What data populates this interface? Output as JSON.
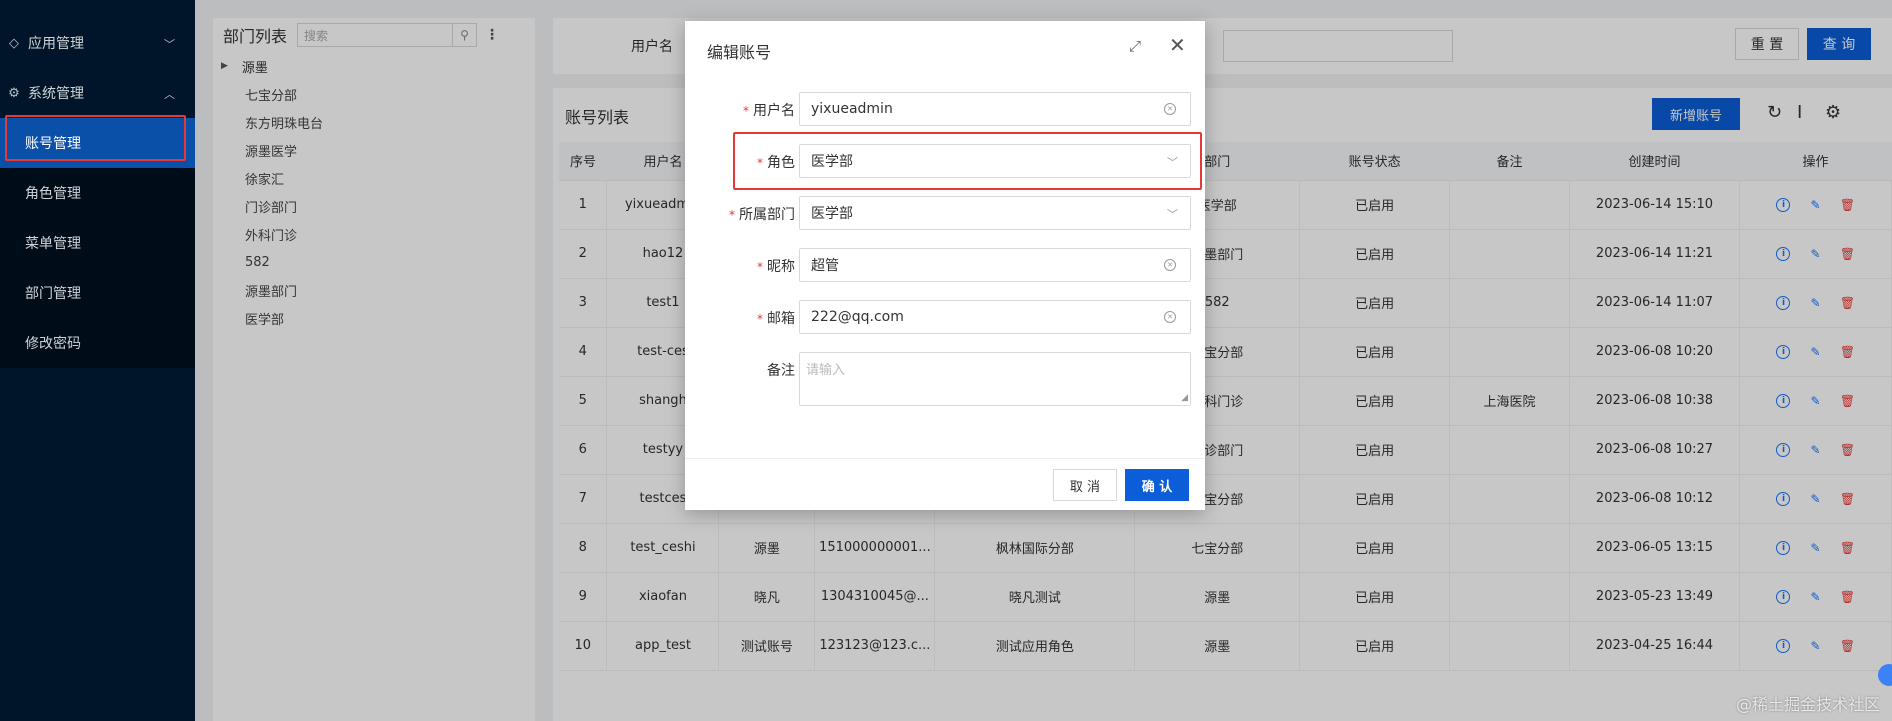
{
  "sidebar": {
    "groups": [
      {
        "label": "应用管理",
        "icon": "diamond-icon",
        "expanded": false
      },
      {
        "label": "系统管理",
        "icon": "gear-icon",
        "expanded": true
      }
    ],
    "items": [
      {
        "label": "账号管理",
        "active": true
      },
      {
        "label": "角色管理",
        "active": false
      },
      {
        "label": "菜单管理",
        "active": false
      },
      {
        "label": "部门管理",
        "active": false
      },
      {
        "label": "修改密码",
        "active": false
      }
    ]
  },
  "dept": {
    "title": "部门列表",
    "search_placeholder": "搜索",
    "root": "源墨",
    "nodes": [
      "七宝分部",
      "东方明珠电台",
      "源墨医学",
      "徐家汇",
      "门诊部门",
      "外科门诊",
      "582",
      "源墨部门",
      "医学部"
    ]
  },
  "filter": {
    "username_label": "用户名",
    "reset_label": "重 置",
    "query_label": "查 询"
  },
  "table": {
    "title": "账号列表",
    "add_label": "新增账号",
    "columns": [
      "序号",
      "用户名",
      "",
      "",
      "",
      "部门",
      "账号状态",
      "备注",
      "创建时间",
      "操作"
    ],
    "rows": [
      {
        "no": "1",
        "username": "yixueadmin",
        "nickname": "",
        "email": "",
        "role": "",
        "dept": "医学部",
        "status": "已启用",
        "remark": "",
        "created": "2023-06-14 15:10"
      },
      {
        "no": "2",
        "username": "hao12",
        "nickname": "",
        "email": "",
        "role": "",
        "dept": "源墨部门",
        "status": "已启用",
        "remark": "",
        "created": "2023-06-14 11:21"
      },
      {
        "no": "3",
        "username": "test1",
        "nickname": "",
        "email": "",
        "role": "",
        "dept": "582",
        "status": "已启用",
        "remark": "",
        "created": "2023-06-14 11:07"
      },
      {
        "no": "4",
        "username": "test-ces",
        "nickname": "",
        "email": "",
        "role": "",
        "dept": "七宝分部",
        "status": "已启用",
        "remark": "",
        "created": "2023-06-08 10:20"
      },
      {
        "no": "5",
        "username": "shangh",
        "nickname": "",
        "email": "",
        "role": "",
        "dept": "外科门诊",
        "status": "已启用",
        "remark": "上海医院",
        "created": "2023-06-08 10:38"
      },
      {
        "no": "6",
        "username": "testyy",
        "nickname": "",
        "email": "",
        "role": "",
        "dept": "门诊部门",
        "status": "已启用",
        "remark": "",
        "created": "2023-06-08 10:27"
      },
      {
        "no": "7",
        "username": "testces",
        "nickname": "",
        "email": "",
        "role": "",
        "dept": "七宝分部",
        "status": "已启用",
        "remark": "",
        "created": "2023-06-08 10:12"
      },
      {
        "no": "8",
        "username": "test_ceshi",
        "nickname": "源墨",
        "email": "151000000001...",
        "role": "枫林国际分部",
        "dept": "七宝分部",
        "status": "已启用",
        "remark": "",
        "created": "2023-06-05 13:15"
      },
      {
        "no": "9",
        "username": "xiaofan",
        "nickname": "晓凡",
        "email": "1304310045@...",
        "role": "晓凡测试",
        "dept": "源墨",
        "status": "已启用",
        "remark": "",
        "created": "2023-05-23 13:49"
      },
      {
        "no": "10",
        "username": "app_test",
        "nickname": "测试账号",
        "email": "123123@123.c...",
        "role": "测试应用角色",
        "dept": "源墨",
        "status": "已启用",
        "remark": "",
        "created": "2023-04-25 16:44"
      }
    ]
  },
  "modal": {
    "title": "编辑账号",
    "fields": {
      "username": {
        "label": "用户名",
        "value": "yixueadmin"
      },
      "role": {
        "label": "角色",
        "value": "医学部"
      },
      "dept": {
        "label": "所属部门",
        "value": "医学部"
      },
      "nickname": {
        "label": "昵称",
        "value": "超管"
      },
      "email": {
        "label": "邮箱",
        "value": "222@qq.com"
      },
      "remark": {
        "label": "备注",
        "placeholder": "请输入"
      }
    },
    "cancel_label": "取 消",
    "ok_label": "确 认"
  },
  "watermark": "@稀土掘金技术社区",
  "colors": {
    "sidebar_bg": "#001529",
    "primary": "#0b5ed7",
    "danger": "#e53935",
    "highlight_box": "#e53935"
  }
}
